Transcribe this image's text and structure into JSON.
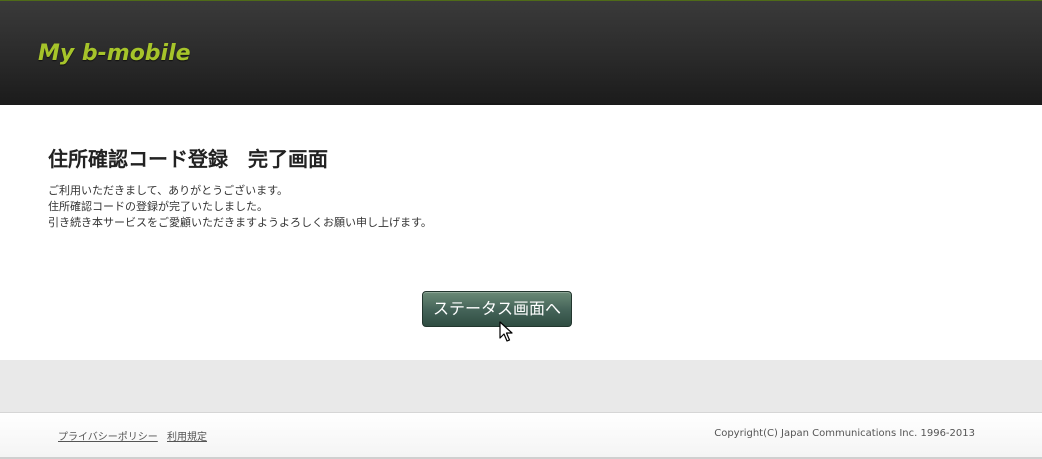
{
  "header": {
    "logo_text": "My b-mobile"
  },
  "main": {
    "title": "住所確認コード登録　完了画面",
    "message_lines": [
      "ご利用いただきまして、ありがとうございます。",
      "住所確認コードの登録が完了いたしました。",
      "引き続き本サービスをご愛顧いただきますようよろしくお願い申し上げます。"
    ],
    "status_button_label": "ステータス画面へ"
  },
  "footer": {
    "links": [
      "プライバシーポリシー",
      "利用規定"
    ],
    "copyright": "Copyright(C) Japan Communications Inc. 1996-2013"
  },
  "colors": {
    "header_bg": "#2a2a2a",
    "logo": "#a6c42a",
    "button_bg": "#46655a"
  }
}
